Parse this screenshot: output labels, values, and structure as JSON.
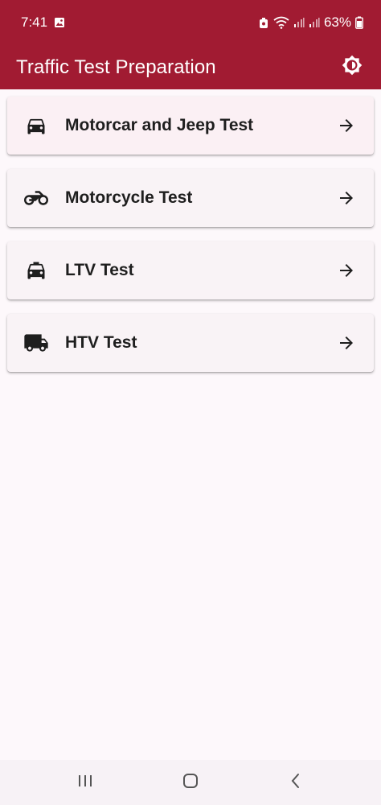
{
  "status_bar": {
    "time": "7:41",
    "battery_percent": "63%",
    "icons": [
      "gallery-icon",
      "alarm-icon",
      "wifi-icon",
      "signal-icon",
      "battery-icon"
    ]
  },
  "app_bar": {
    "title": "Traffic Test Preparation",
    "background_color": "#a11b32",
    "action_icon": "brightness-icon"
  },
  "tests": [
    {
      "label": "Motorcar and Jeep Test",
      "icon": "car-icon"
    },
    {
      "label": "Motorcycle Test",
      "icon": "motorcycle-icon"
    },
    {
      "label": "LTV Test",
      "icon": "taxi-icon"
    },
    {
      "label": "HTV Test",
      "icon": "truck-icon"
    }
  ],
  "nav_bar": {
    "buttons": [
      "recent-apps-icon",
      "home-icon",
      "back-icon"
    ]
  }
}
